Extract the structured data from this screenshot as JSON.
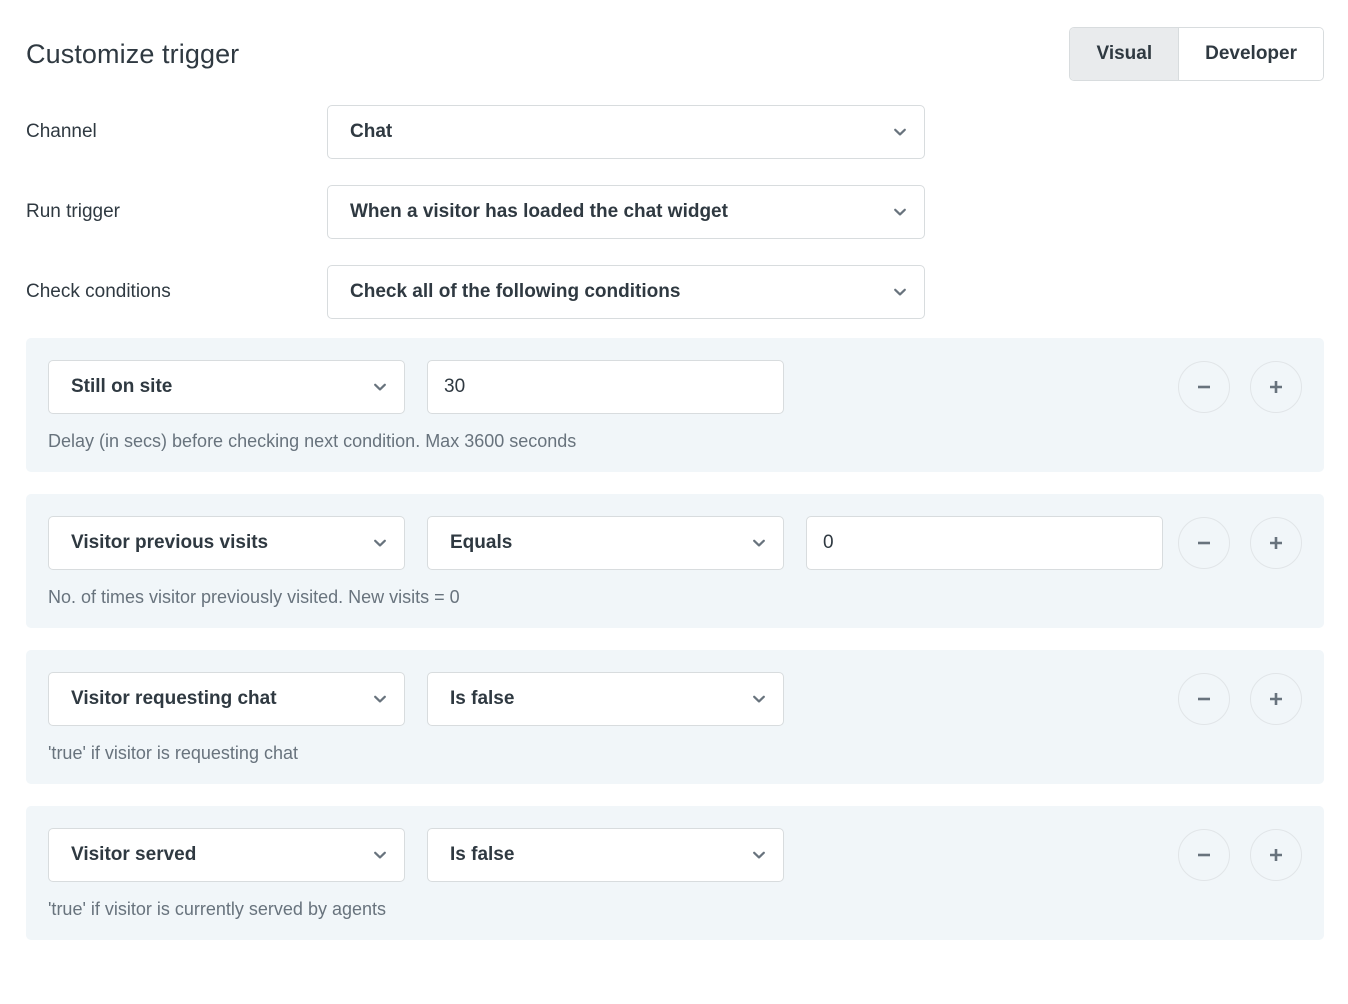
{
  "header": {
    "title": "Customize trigger",
    "mode_toggle": {
      "options": [
        {
          "label": "Visual",
          "selected": true
        },
        {
          "label": "Developer",
          "selected": false
        }
      ]
    }
  },
  "form": {
    "fields": [
      {
        "label": "Channel",
        "value": "Chat"
      },
      {
        "label": "Run trigger",
        "value": "When a visitor has loaded the chat widget"
      },
      {
        "label": "Check conditions",
        "value": "Check all of the following conditions"
      }
    ]
  },
  "conditions": [
    {
      "attribute": "Still on site",
      "operator": null,
      "value": "30",
      "helper": "Delay (in secs) before checking next condition. Max 3600 seconds",
      "remove_label": "minus-icon",
      "add_label": "plus-icon"
    },
    {
      "attribute": "Visitor previous visits",
      "operator": "Equals",
      "value": "0",
      "helper": "No. of times visitor previously visited. New visits = 0",
      "remove_label": "minus-icon",
      "add_label": "plus-icon"
    },
    {
      "attribute": "Visitor requesting chat",
      "operator": "Is false",
      "value": null,
      "helper": "'true' if visitor is requesting chat",
      "remove_label": "minus-icon",
      "add_label": "plus-icon"
    },
    {
      "attribute": "Visitor served",
      "operator": "Is false",
      "value": null,
      "helper": "'true' if visitor is currently served by agents",
      "remove_label": "minus-icon",
      "add_label": "plus-icon"
    }
  ],
  "colors": {
    "text_primary": "#2f3941",
    "text_secondary": "#68737d",
    "border": "#d8dcde",
    "card_background": "#f1f6f9",
    "toggle_selected_background": "#e9ebed",
    "page_background": "#ffffff"
  }
}
